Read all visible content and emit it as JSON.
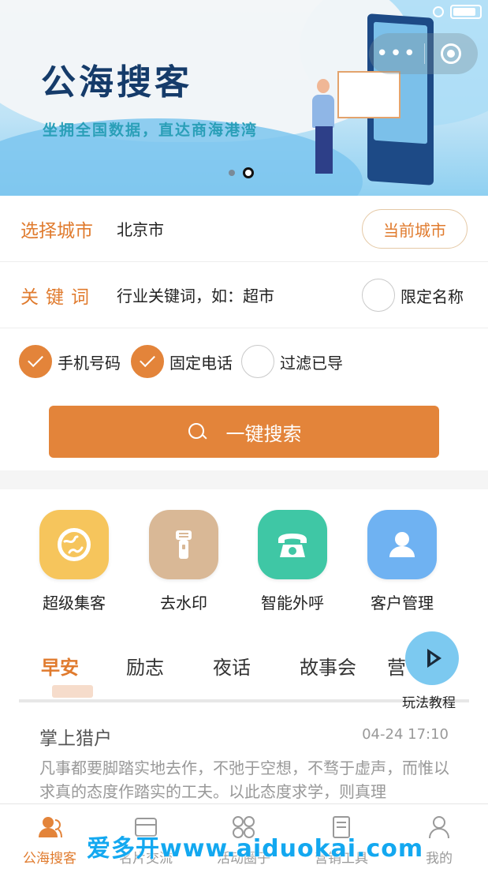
{
  "banner": {
    "title": "公海搜客",
    "subtitle": "坐拥全国数据，直达商海港湾",
    "carousel_index": 2,
    "carousel_count": 2
  },
  "capsule": {
    "more": "•••"
  },
  "form": {
    "city_label": "选择城市",
    "city_value": "北京市",
    "current_city_button": "当前城市",
    "keyword_label": "关键词",
    "keyword_placeholder": "行业关键词，如：超市",
    "limit_name_label": "限定名称",
    "limit_name_checked": false,
    "options": [
      {
        "label": "手机号码",
        "checked": true
      },
      {
        "label": "固定电话",
        "checked": true
      },
      {
        "label": "过滤已导",
        "checked": false
      }
    ],
    "search_button": "一键搜索"
  },
  "features": [
    {
      "label": "超级集客",
      "icon": "globe-icon",
      "color": "#f6c55c"
    },
    {
      "label": "去水印",
      "icon": "flashlight-icon",
      "color": "#d9b896"
    },
    {
      "label": "智能外呼",
      "icon": "telephone-icon",
      "color": "#3fc7a5"
    },
    {
      "label": "客户管理",
      "icon": "user-icon",
      "color": "#6fb2f2"
    }
  ],
  "tabs": [
    "早安",
    "励志",
    "夜话",
    "故事会",
    "营"
  ],
  "active_tab": "早安",
  "tutorial_label": "玩法教程",
  "article": {
    "title": "掌上猎户",
    "time": "04-24 17:10",
    "body": "凡事都要脚踏实地去作，不弛于空想，不骛于虚声，而惟以求真的态度作踏实的工夫。以此态度求学，则真理"
  },
  "tabbar": [
    {
      "label": "公海搜客",
      "icon": "customers-icon",
      "active": true
    },
    {
      "label": "名片交流",
      "icon": "card-icon",
      "active": false
    },
    {
      "label": "活动圈子",
      "icon": "circles-icon",
      "active": false
    },
    {
      "label": "营销工具",
      "icon": "document-icon",
      "active": false
    },
    {
      "label": "我的",
      "icon": "profile-icon",
      "active": false
    }
  ],
  "watermark": "爱多开www.aiduokai.com",
  "colors": {
    "accent": "#e3843a",
    "text_accent": "#e07b2e"
  }
}
